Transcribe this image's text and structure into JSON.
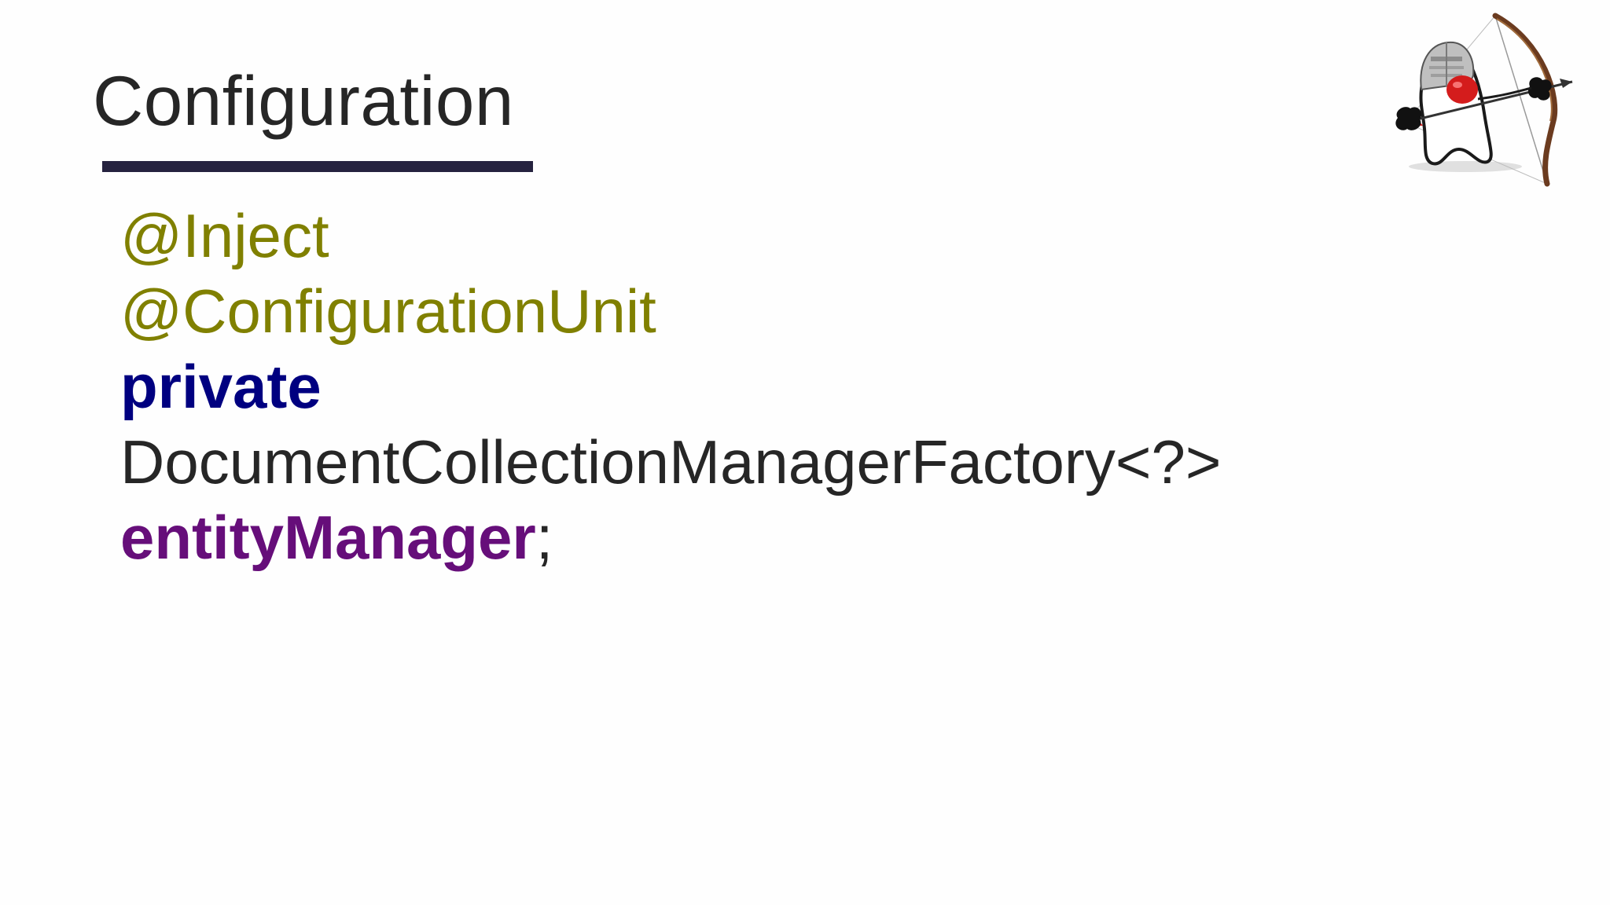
{
  "slide": {
    "title": "Configuration",
    "code": {
      "annotation_inject": "@Inject",
      "annotation_configuration_unit": "@ConfigurationUnit",
      "keyword_private": "private",
      "type_name": "DocumentCollectionManagerFactory<?>",
      "field_name": "entityManager",
      "terminator": ";"
    },
    "logo": {
      "icon": "duke-archer-mascot-icon"
    }
  },
  "colors": {
    "annotation": "#808000",
    "keyword": "#000080",
    "field": "#660e7a",
    "text": "#262626",
    "rule": "#25223f"
  }
}
